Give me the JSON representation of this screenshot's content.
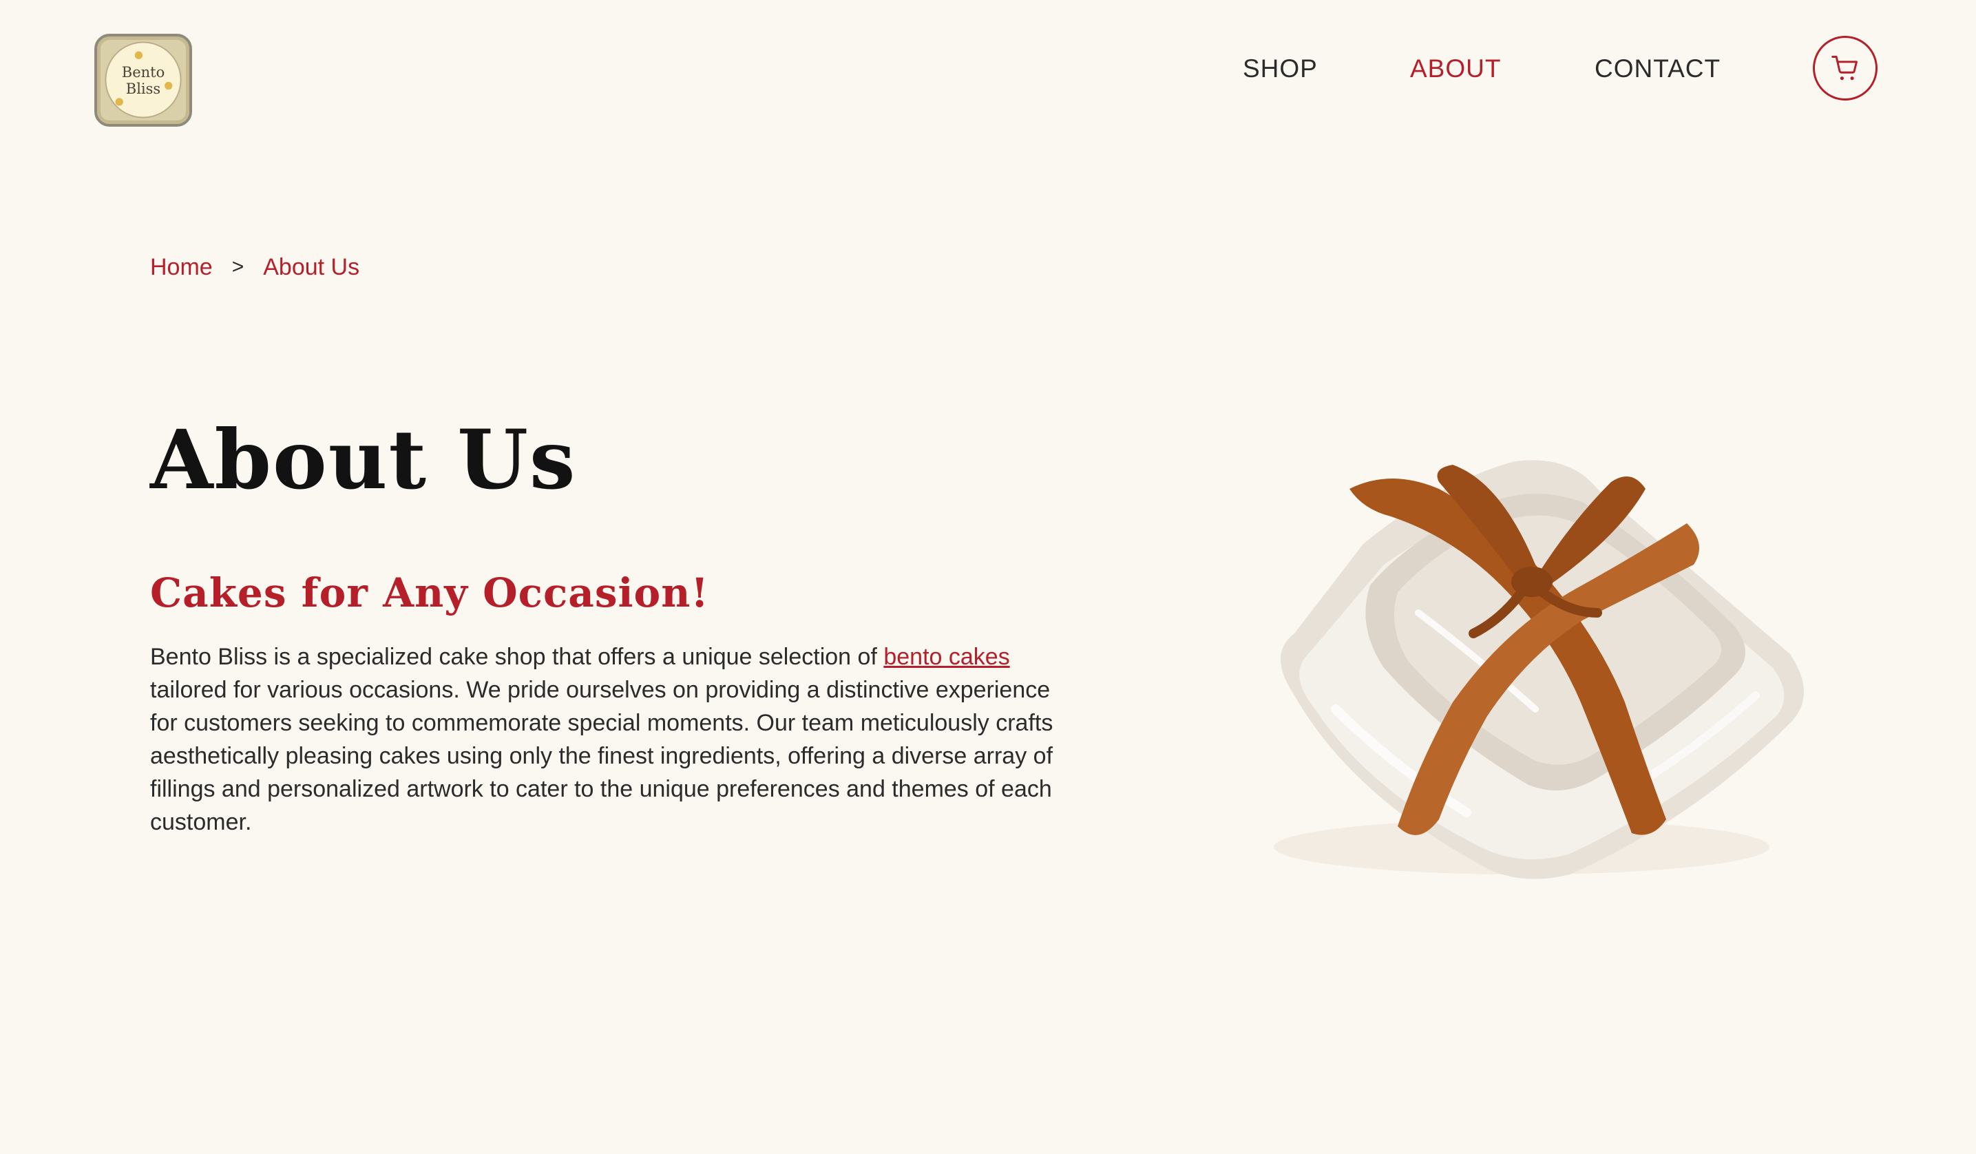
{
  "logo": {
    "line1": "Bento",
    "line2": "Bliss"
  },
  "nav": {
    "items": [
      {
        "label": "SHOP"
      },
      {
        "label": "ABOUT"
      },
      {
        "label": "CONTACT"
      }
    ]
  },
  "cart": {
    "icon": "shopping-cart-icon"
  },
  "breadcrumb": {
    "home": "Home",
    "separator": ">",
    "current": "About Us"
  },
  "main": {
    "title": "About Us",
    "subtitle": "Cakes for Any Occasion!",
    "intro_before_link": "Bento Bliss is a specialized cake shop that offers a unique selection of ",
    "link_text": "bento cakes",
    "intro_after_link": " tailored for various occasions. We pride ourselves on providing a distinctive experience for customers seeking to commemorate special moments. Our team meticulously crafts aesthetically pleasing cakes using only the finest ingredients, offering a diverse array of fillings and personalized artwork to cater to the unique preferences and themes of each customer."
  },
  "colors": {
    "background": "#fbf8f2",
    "accent": "#b51f2a",
    "text": "#2b2b2b",
    "ribbon": "#a9561c"
  }
}
